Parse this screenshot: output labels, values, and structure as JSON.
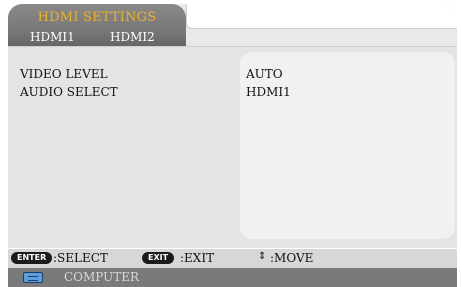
{
  "tabs": {
    "active_title": "HDMI SETTINGS",
    "sub": [
      "HDMI1",
      "HDMI2"
    ]
  },
  "settings": [
    {
      "label": "VIDEO LEVEL",
      "value": "AUTO"
    },
    {
      "label": "AUDIO SELECT",
      "value": "HDMI1"
    }
  ],
  "statusbar": {
    "enter_key": "ENTER",
    "enter_text": ":SELECT",
    "exit_key": "EXIT",
    "exit_text": ":EXIT",
    "move_symbol": "⇕",
    "move_text": ":MOVE"
  },
  "bottom": {
    "label": "COMPUTER",
    "icon": "vga-connector-icon"
  },
  "colors": {
    "active_tab_text": "#f0b020",
    "panel_bg": "#e4e4e4",
    "value_box_bg": "#f1f1f1"
  }
}
